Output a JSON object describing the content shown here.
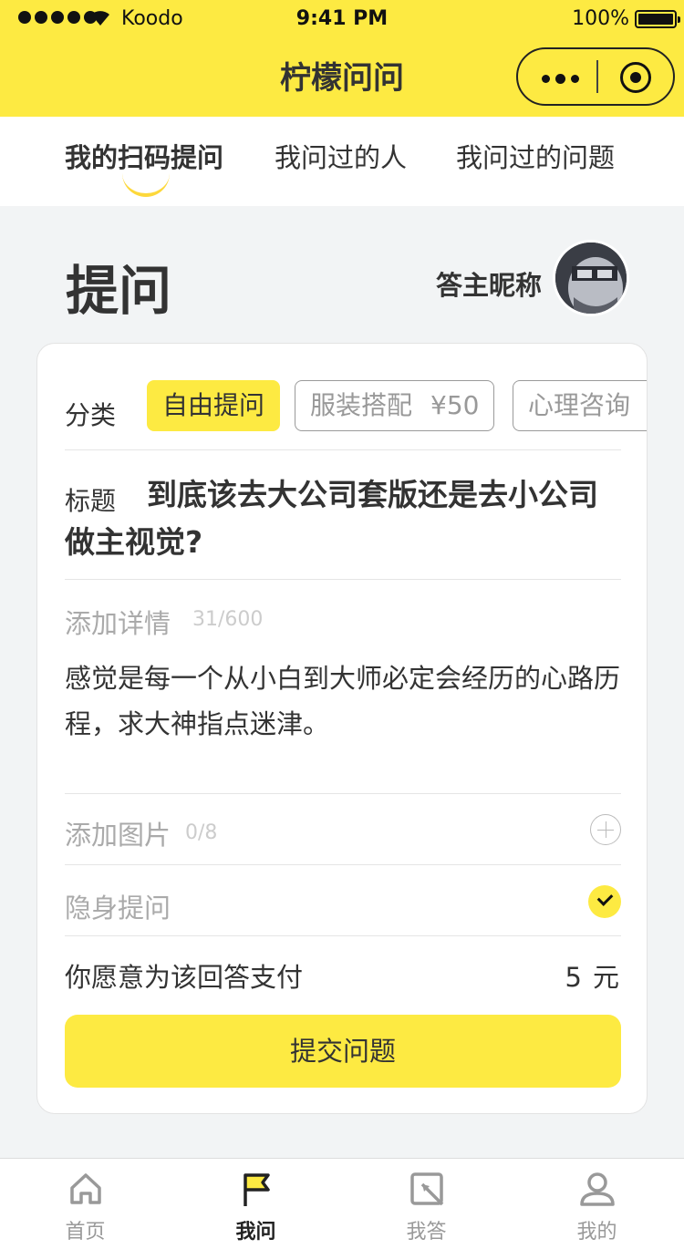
{
  "status_bar": {
    "carrier": "Koodo",
    "time": "9:41 PM",
    "battery": "100%"
  },
  "header": {
    "title": "柠檬问问"
  },
  "tabs": [
    {
      "label": "我的扫码提问",
      "active": true
    },
    {
      "label": "我问过的人",
      "active": false
    },
    {
      "label": "我问过的问题",
      "active": false
    }
  ],
  "page": {
    "heading": "提问",
    "answerer_name": "答主昵称"
  },
  "form": {
    "category_label": "分类",
    "categories": [
      {
        "name": "自由提问",
        "price": "",
        "selected": true
      },
      {
        "name": "服装搭配",
        "price": "¥50",
        "selected": false
      },
      {
        "name": "心理咨询",
        "price": "¥",
        "selected": false
      }
    ],
    "title_label": "标题",
    "title_value": "到底该去大公司套版还是去小公司做主视觉?",
    "detail_label": "添加详情",
    "detail_count": "31/600",
    "detail_value": "感觉是每一个从小白到大师必定会经历的心路历程，求大神指点迷津。",
    "image_label": "添加图片",
    "image_count": "0/8",
    "anonymous_label": "隐身提问",
    "anonymous_checked": true,
    "pay_label": "你愿意为该回答支付",
    "pay_amount": "5",
    "pay_unit": "元",
    "submit_label": "提交问题"
  },
  "tabbar": [
    {
      "label": "首页",
      "icon": "home-icon",
      "active": false
    },
    {
      "label": "我问",
      "icon": "flag-icon",
      "active": true
    },
    {
      "label": "我答",
      "icon": "edit-square-icon",
      "active": false
    },
    {
      "label": "我的",
      "icon": "user-icon",
      "active": false
    }
  ],
  "colors": {
    "brand_yellow": "#fdea42",
    "text": "#333333",
    "muted": "#aaaaaa",
    "background": "#f2f4f5"
  }
}
